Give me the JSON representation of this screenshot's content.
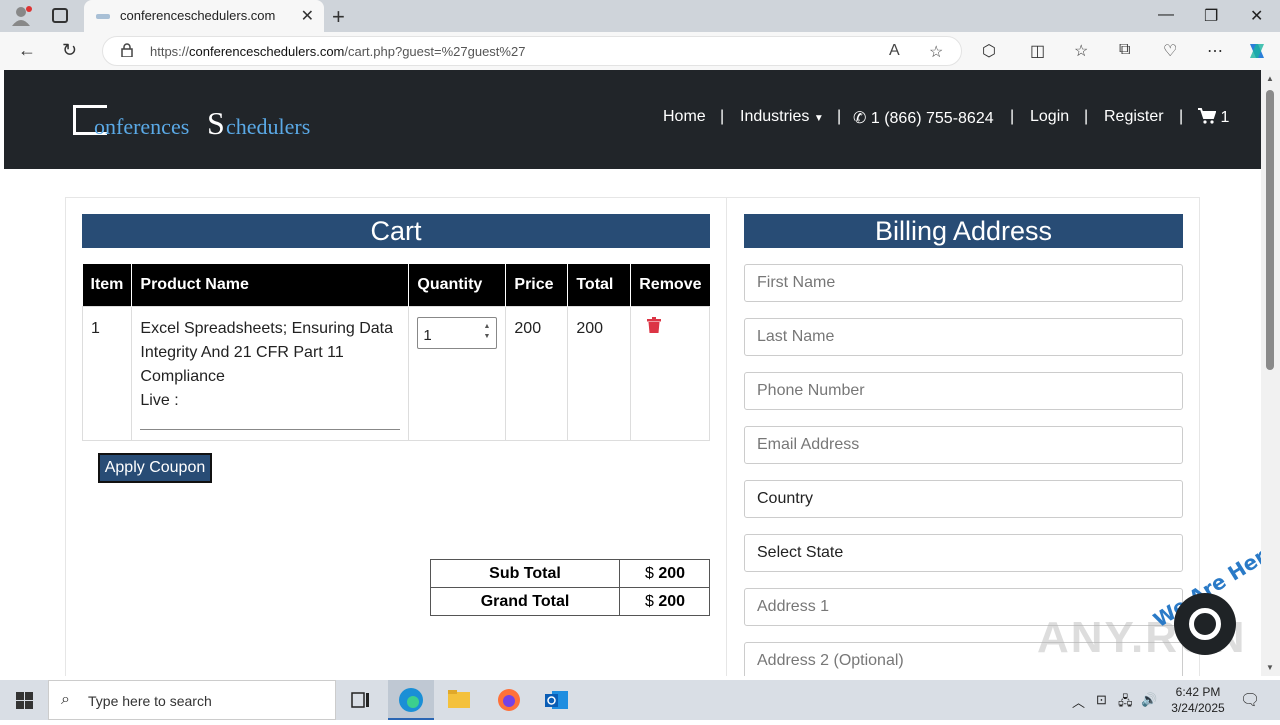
{
  "browser": {
    "tab_title": "conferenceschedulers.com",
    "url_prefix": "https://",
    "url_domain": "conferenceschedulers.com",
    "url_path": "/cart.php?guest=%27guest%27"
  },
  "site": {
    "logo_part1": "onferences",
    "logo_s": "S",
    "logo_part2": "chedulers",
    "nav": {
      "home": "Home",
      "industries": "Industries",
      "phone": "1 (866) 755-8624",
      "login": "Login",
      "register": "Register",
      "cart_count": "1"
    }
  },
  "cart": {
    "title": "Cart",
    "headers": [
      "Item",
      "Product Name",
      "Quantity",
      "Price",
      "Total",
      "Remove"
    ],
    "rows": [
      {
        "item": "1",
        "product": "Excel Spreadsheets; Ensuring Data Integrity And 21 CFR Part 11 Compliance",
        "live": "Live :",
        "quantity": "1",
        "price": "200",
        "total": "200"
      }
    ],
    "coupon_button": "Apply Coupon",
    "subtotal_label": "Sub Total",
    "subtotal_currency": "$",
    "subtotal_value": "200",
    "grandtotal_label": "Grand Total",
    "grandtotal_currency": "$",
    "grandtotal_value": "200"
  },
  "billing": {
    "title": "Billing Address",
    "first_name": "First Name",
    "last_name": "Last Name",
    "phone": "Phone Number",
    "email": "Email Address",
    "country": "Country",
    "state": "Select State",
    "address1": "Address 1",
    "address2": "Address 2 (Optional)"
  },
  "chat": {
    "label": "We Are Here!"
  },
  "watermark": "ANY.RUN",
  "taskbar": {
    "search_placeholder": "Type here to search",
    "time": "6:42 PM",
    "date": "3/24/2025"
  },
  "colors": {
    "header_bg": "#212529",
    "banner_bg": "#284c75",
    "trash": "#dc3545",
    "logo_accent": "#5aa9e6"
  }
}
